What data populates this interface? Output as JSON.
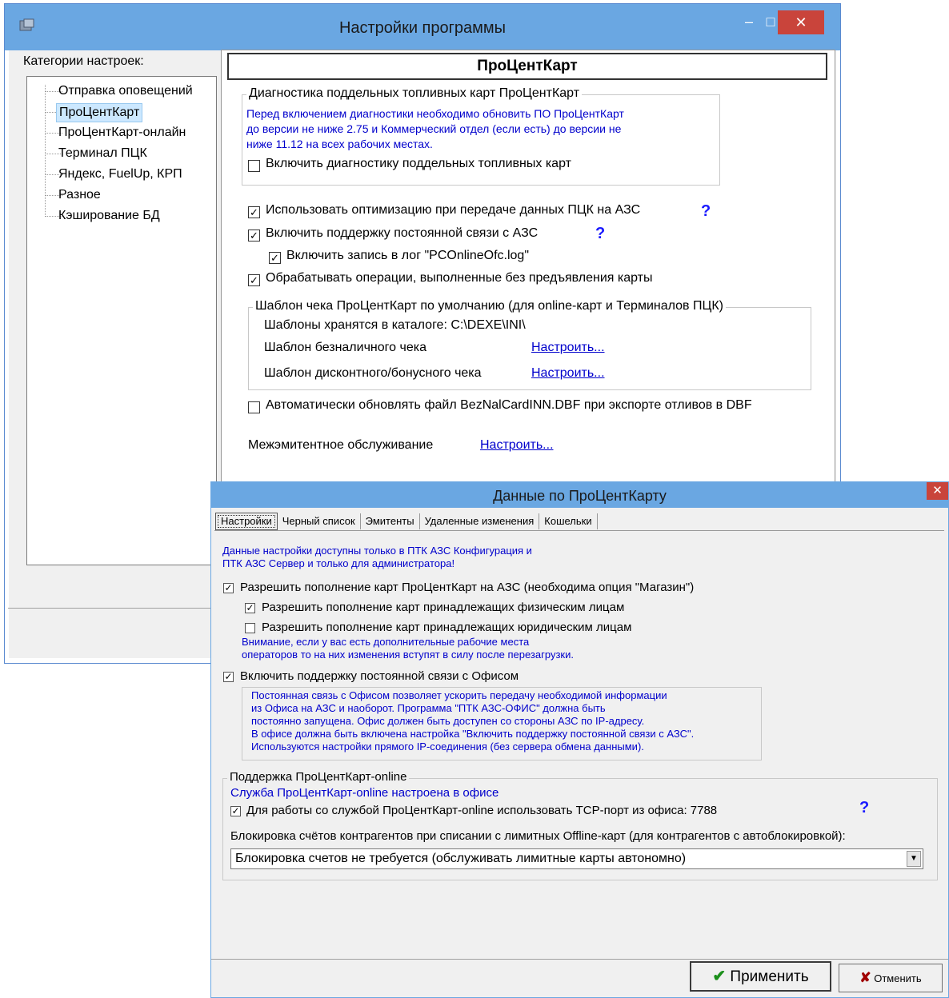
{
  "main_window": {
    "title": "Настройки программы",
    "controls": {
      "minimize": "–",
      "maximize": "□",
      "close": "✕"
    },
    "categories_label": "Категории настроек:",
    "tree_items": [
      "Отправка оповещений",
      "ПроЦентКарт",
      "ПроЦентКарт-онлайн",
      "Терминал ПЦК",
      "Яндекс, FuelUp, КРП",
      "Разное",
      "Кэширование БД"
    ],
    "selected_item": "ПроЦентКарт",
    "panel": {
      "header": "ПроЦентКарт",
      "fake_cards_group": {
        "title": "Диагностика поддельных топливных карт ПроЦентКарт",
        "note_lines": [
          "Перед включением диагностики необходимо обновить ПО ПроЦентКарт",
          "до версии не ниже 2.75 и Коммерческий отдел (если есть) до версии не",
          "ниже 11.12 на всех рабочих местах."
        ],
        "checkbox_label": "Включить диагностику поддельных топливных карт"
      },
      "opt_label": "Использовать оптимизацию при передаче данных ПЦК на АЗС",
      "const_conn_label": "Включить поддержку постоянной связи с АЗС",
      "log_label": "Включить запись в лог \"PCOnlineOfc.log\"",
      "no_card_label": "Обрабатывать операции, выполненные без предъявления карты",
      "help": "?",
      "receipt_group": {
        "title": "Шаблон чека ПроЦентКарт по умолчанию (для online-карт и Терминалов ПЦК)",
        "path_label": "Шаблоны хранятся в каталоге: C:\\DEXE\\INI\\",
        "cashless_label": "Шаблон безналичного чека",
        "discount_label": "Шаблон дисконтного/бонусного чека",
        "configure": "Настроить..."
      },
      "auto_update_label": "Автоматически обновлять файл  BezNalCardINN.DBF при экспорте отливов в DBF",
      "inter_emitter_label": "Межэмитентное обслуживание",
      "configure": "Настроить..."
    }
  },
  "dialog": {
    "title": "Данные по ПроЦентКарту",
    "close": "✕",
    "tabs": [
      "Настройки",
      "Черный список",
      "Эмитенты",
      "Удаленные изменения",
      "Кошельки"
    ],
    "admin_note": [
      "Данные настройки доступны только в ПТК АЗС Конфигурация и",
      "ПТК АЗС Сервер и только для администратора!"
    ],
    "allow_topup_label": "Разрешить пополнение карт ПроЦентКарт на АЗС (необходима опция \"Магазин\")",
    "allow_individuals_label": "Разрешить пополнение карт принадлежащих физическим лицам",
    "allow_legal_label": "Разрешить пополнение карт принадлежащих юридическим лицам",
    "warning_note": [
      "Внимание, если у вас есть дополнительные рабочие места",
      "операторов то на них изменения вступят в силу после перезагрузки."
    ],
    "office_conn_label": "Включить поддержку постоянной связи с Офисом",
    "office_note": [
      "Постоянная связь с Офисом позволяет ускорить передачу необходимой информации",
      "из Офиса на АЗС и наоборот. Программа \"ПТК АЗС-ОФИС\" должна быть",
      "постоянно запущена. Офис должен быть доступен со стороны АЗС по IP-адресу.",
      "В офисе должна быть включена настройка \"Включить поддержку постоянной связи с АЗС\".",
      "Используются настройки прямого IP-соединения (без сервера обмена данными)."
    ],
    "online_group": {
      "title": "Поддержка ПроЦентКарт-online",
      "service_status": "Служба ПроЦентКарт-online настроена в офисе",
      "tcp_label": "Для работы со службой ПроЦентКарт-online использовать TCP-порт из офиса:  7788",
      "help": "?",
      "blocking_label": "Блокировка счётов контрагентов при списании с лимитных Offline-карт (для контрагентов с автоблокировкой):",
      "blocking_value": "Блокировка счетов не требуется (обслуживать лимитные карты автономно)"
    },
    "apply_button": "Применить",
    "cancel_button": "Отменить"
  }
}
